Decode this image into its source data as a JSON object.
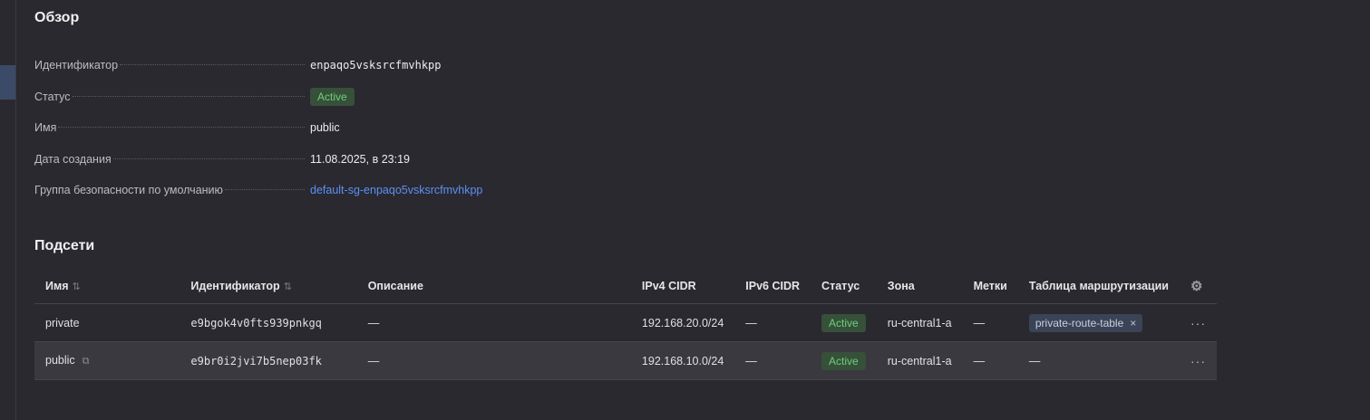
{
  "overview": {
    "title": "Обзор",
    "fields": [
      {
        "label": "Идентификатор",
        "value": "enpaqo5vsksrcfmvhkpp"
      },
      {
        "label": "Статус",
        "value": "Active"
      },
      {
        "label": "Имя",
        "value": "public"
      },
      {
        "label": "Дата создания",
        "value": "11.08.2025, в 23:19"
      },
      {
        "label": "Группа безопасности по умолчанию",
        "value": "default-sg-enpaqo5vsksrcfmvhkpp"
      }
    ]
  },
  "subnets": {
    "title": "Подсети",
    "columns": {
      "name": "Имя",
      "id": "Идентификатор",
      "description": "Описание",
      "ipv4": "IPv4 CIDR",
      "ipv6": "IPv6 CIDR",
      "status": "Статус",
      "zone": "Зона",
      "labels": "Метки",
      "route_table": "Таблица маршрутизации"
    },
    "rows": [
      {
        "name": "private",
        "id": "e9bgok4v0fts939pnkgq",
        "description": "—",
        "ipv4": "192.168.20.0/24",
        "ipv6": "—",
        "status": "Active",
        "zone": "ru-central1-a",
        "labels": "—",
        "route_table": "private-route-table"
      },
      {
        "name": "public",
        "id": "e9br0i2jvi7b5nep03fk",
        "description": "—",
        "ipv4": "192.168.10.0/24",
        "ipv6": "—",
        "status": "Active",
        "zone": "ru-central1-a",
        "labels": "—",
        "route_table": "—"
      }
    ]
  },
  "icons": {
    "sort": "sort-icon",
    "copy": "copy-icon",
    "settings": "gear-icon",
    "more": "more-icon",
    "remove": "close-icon"
  },
  "colors": {
    "background": "#2a292f",
    "status_active_bg": "#36503a",
    "status_active_text": "#6fd07a",
    "link": "#5c8ff5"
  }
}
